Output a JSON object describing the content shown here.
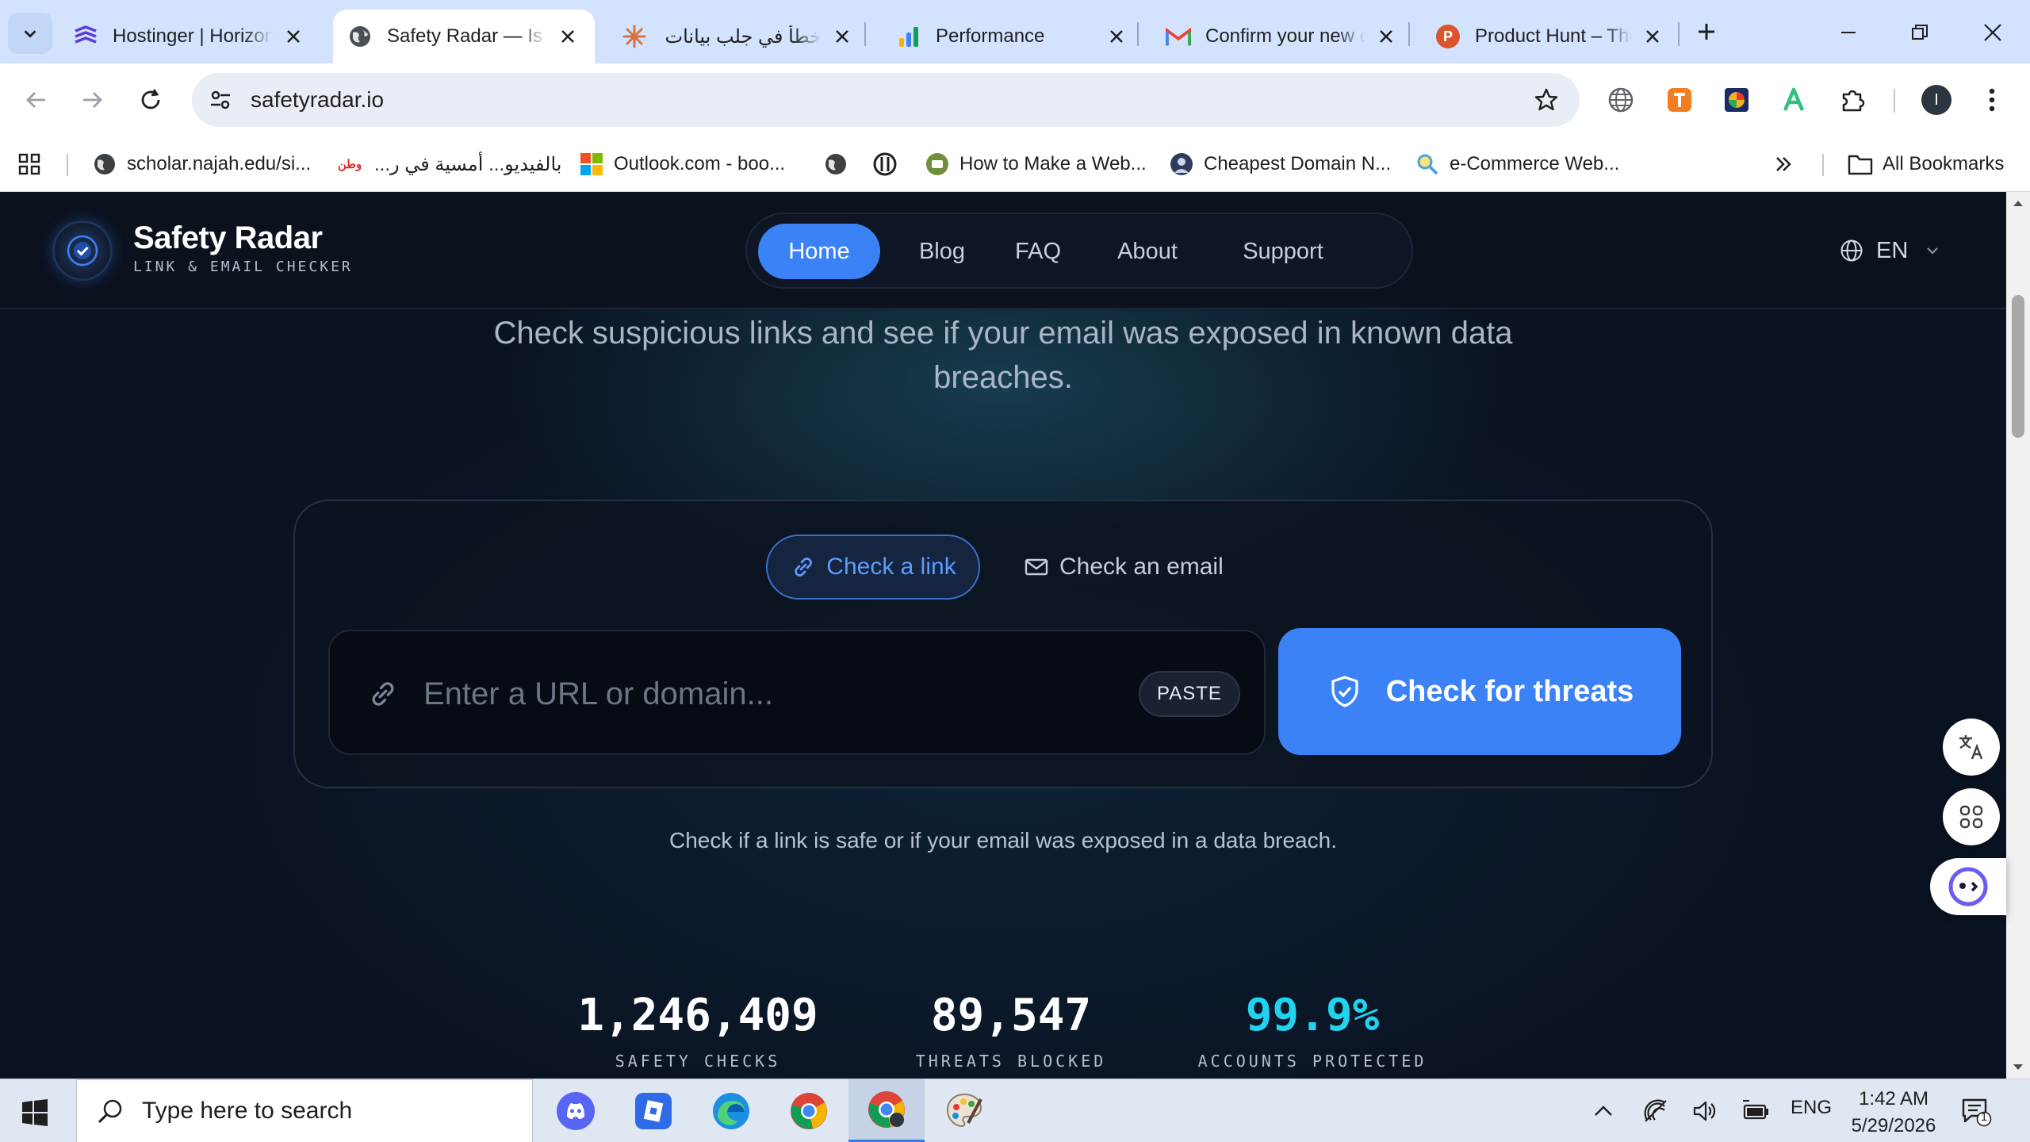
{
  "browser": {
    "tabs": [
      {
        "title": "Hostinger | Horizons"
      },
      {
        "title": "Safety Radar — Is This Link Safe?"
      },
      {
        "title": "خطأ في جلب بيانات"
      },
      {
        "title": "Performance"
      },
      {
        "title": "Confirm your new email"
      },
      {
        "title": "Product Hunt – The best new products"
      }
    ],
    "url": "safetyradar.io",
    "bookmarks": [
      {
        "label": "scholar.najah.edu/si..."
      },
      {
        "label": "بالفيديو... أمسية في ر..."
      },
      {
        "label": "Outlook.com - boo..."
      },
      {
        "label": "How to Make a Web..."
      },
      {
        "label": "Cheapest Domain N..."
      },
      {
        "label": "e-Commerce Web..."
      }
    ],
    "bookmark_badge": "وطن",
    "all_bookmarks": "All Bookmarks",
    "profile_initial": "I"
  },
  "site": {
    "brand": "Safety Radar",
    "brand_sub": "LINK & EMAIL CHECKER",
    "nav": [
      "Home",
      "Blog",
      "FAQ",
      "About",
      "Support"
    ],
    "lang": "EN",
    "tagline": "Check suspicious links and see if your email was exposed in known data breaches.",
    "modes": {
      "link": "Check a link",
      "email": "Check an email"
    },
    "input_placeholder": "Enter a URL or domain...",
    "paste": "PASTE",
    "check": "Check for threats",
    "helper": "Check if a link is safe or if your email was exposed in a data breach.",
    "stats": [
      {
        "value": "1,246,409",
        "label": "SAFETY CHECKS",
        "color": "#ffffff"
      },
      {
        "value": "89,547",
        "label": "THREATS BLOCKED",
        "color": "#ffffff"
      },
      {
        "value": "99.9%",
        "label": "ACCOUNTS PROTECTED",
        "color": "#22d3ee"
      }
    ],
    "accent": "#3b82f6"
  },
  "taskbar": {
    "search_placeholder": "Type here to search",
    "lang": "ENG",
    "time": "1:42 AM",
    "date": "5/29/2026",
    "notification_count": "1"
  }
}
